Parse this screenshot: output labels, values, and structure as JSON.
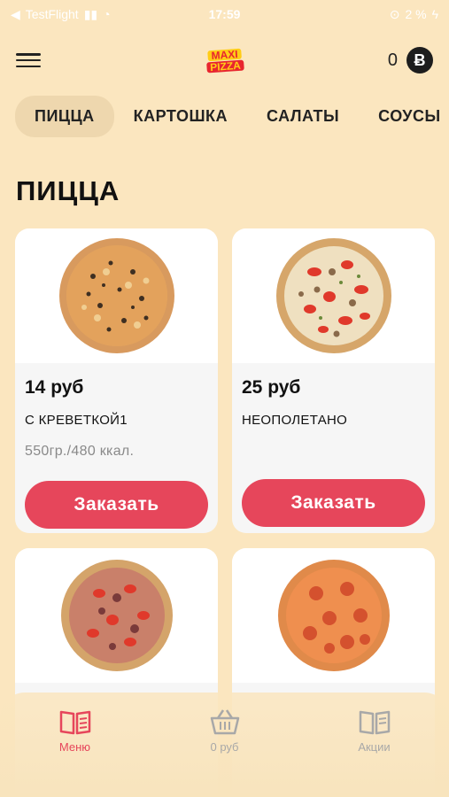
{
  "status_bar": {
    "carrier": "TestFlight",
    "time": "17:59",
    "battery": "2 %"
  },
  "header": {
    "logo_line1": "MAXI",
    "logo_line2": "PIZZA",
    "balance": "0",
    "coin_symbol": "Ƀ"
  },
  "tabs": [
    {
      "label": "ПИЦЦА",
      "active": true
    },
    {
      "label": "КАРТОШКА",
      "active": false
    },
    {
      "label": "САЛАТЫ",
      "active": false
    },
    {
      "label": "СОУСЫ",
      "active": false
    }
  ],
  "section_title": "ПИЦЦА",
  "products": [
    {
      "price": "14 руб",
      "name": "С КРЕВЕТКОЙ1",
      "weight": "550гр./480 ккал.",
      "button": "Заказать"
    },
    {
      "price": "25 руб",
      "name": "НЕОПОЛЕТАНО",
      "weight": "",
      "button": "Заказать"
    },
    {
      "price": "",
      "name": "",
      "weight": "",
      "button": ""
    },
    {
      "price": "",
      "name": "",
      "weight": "",
      "button": ""
    }
  ],
  "bottom_nav": [
    {
      "label": "Меню",
      "icon": "menu-book-icon",
      "active": true
    },
    {
      "label": "0 руб",
      "icon": "basket-icon",
      "active": false
    },
    {
      "label": "Акции",
      "icon": "promo-book-icon",
      "active": false
    }
  ],
  "colors": {
    "background": "#fbe6bf",
    "accent": "#e6465b",
    "tab_active": "#eed7ae"
  }
}
